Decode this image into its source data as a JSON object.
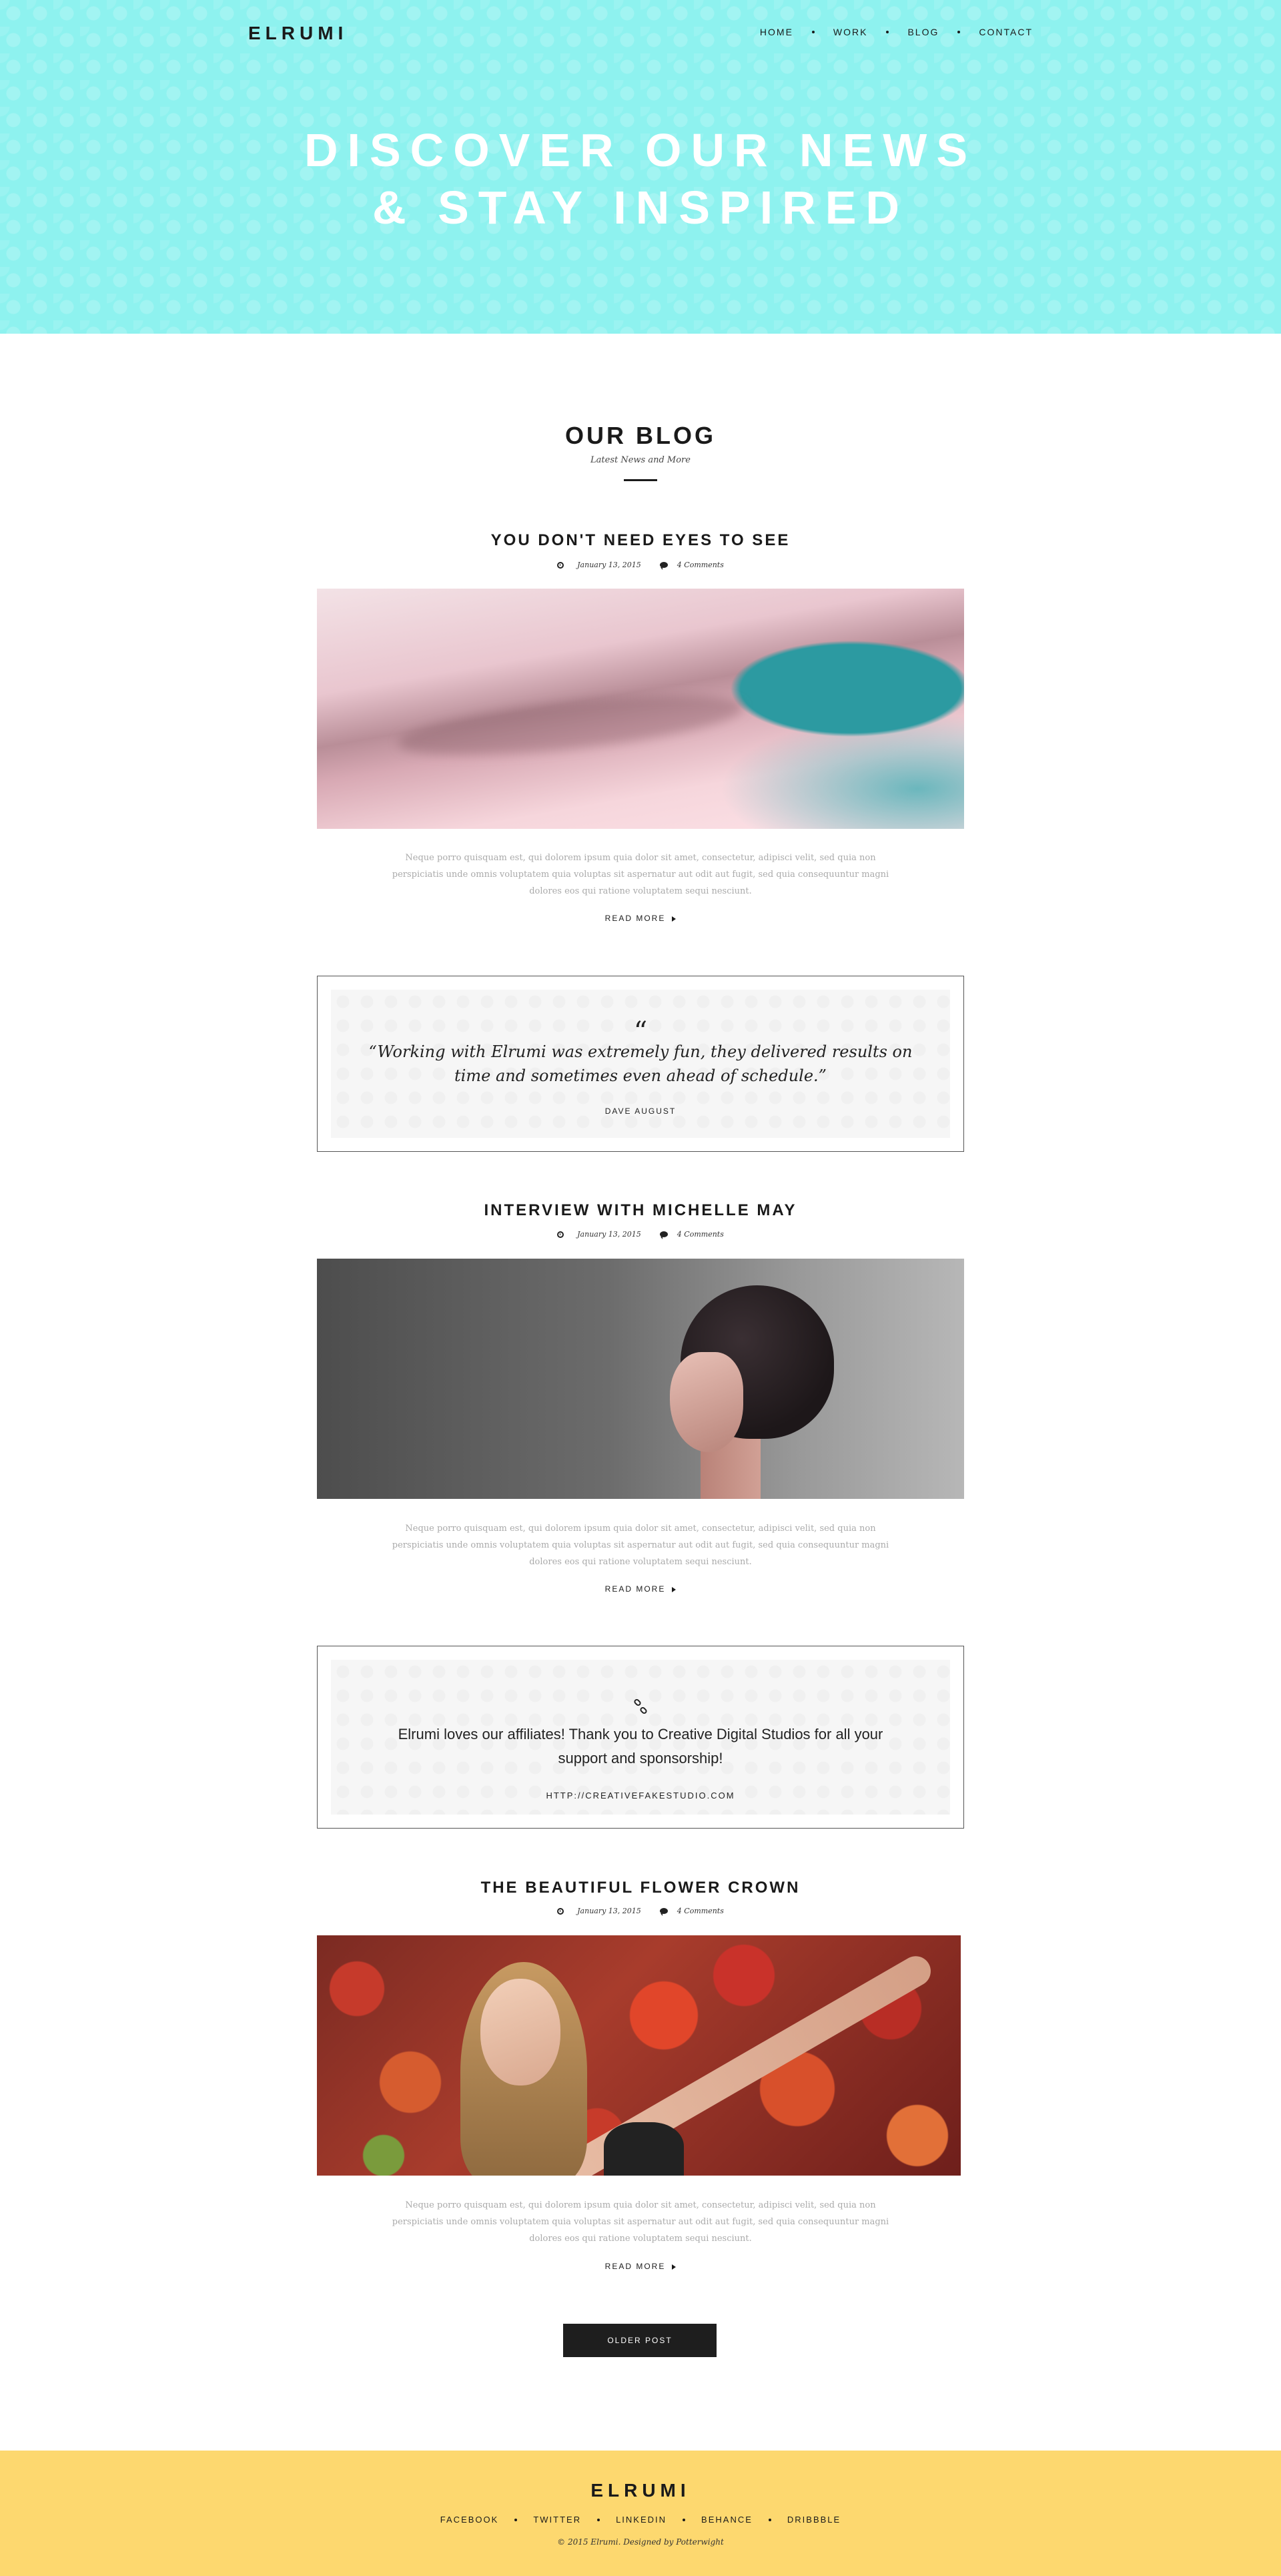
{
  "header": {
    "logo": "ELRUMI",
    "nav": [
      "HOME",
      "WORK",
      "BLOG",
      "CONTACT"
    ]
  },
  "hero": {
    "line1": "DISCOVER OUR NEWS",
    "line2": "& STAY INSPIRED",
    "bg_color": "#8ef2ef"
  },
  "blog": {
    "title": "OUR BLOG",
    "subtitle": "Latest News and More"
  },
  "posts": [
    {
      "title": "YOU DON'T NEED EYES TO SEE",
      "date": "January 13, 2015",
      "comments": "4 Comments",
      "excerpt": "Neque porro quisquam est, qui dolorem ipsum quia dolor sit amet, consectetur, adipisci velit, sed quia non perspiciatis unde omnis voluptatem quia voluptas sit aspernatur aut odit aut fugit, sed quia consequuntur magni dolores eos qui ratione voluptatem sequi nesciunt.",
      "read_more": "READ MORE"
    },
    {
      "title": "INTERVIEW WITH MICHELLE MAY",
      "date": "January 13, 2015",
      "comments": "4 Comments",
      "excerpt": "Neque porro quisquam est, qui dolorem ipsum quia dolor sit amet, consectetur, adipisci velit, sed quia non perspiciatis unde omnis voluptatem quia voluptas sit aspernatur aut odit aut fugit, sed quia consequuntur magni dolores eos qui ratione voluptatem sequi nesciunt.",
      "read_more": "READ MORE"
    },
    {
      "title": "THE BEAUTIFUL FLOWER CROWN",
      "date": "January 13, 2015",
      "comments": "4 Comments",
      "excerpt": "Neque porro quisquam est, qui dolorem ipsum quia dolor sit amet, consectetur, adipisci velit, sed quia non perspiciatis unde omnis voluptatem quia voluptas sit aspernatur aut odit aut fugit, sed quia consequuntur magni dolores eos qui ratione voluptatem sequi nesciunt.",
      "read_more": "READ MORE"
    }
  ],
  "quote": {
    "mark": "“",
    "text": "“Working with Elrumi was extremely fun, they delivered results on time and sometimes even ahead of schedule.”",
    "author": "DAVE AUGUST"
  },
  "link_card": {
    "icon": "link-icon",
    "text": "Elrumi loves our affiliates! Thank you to Creative Digital Studios for all your support and sponsorship!",
    "url": "HTTP://CREATIVEFAKESTUDIO.COM"
  },
  "pagination": {
    "older": "OLDER POST"
  },
  "footer": {
    "logo": "ELRUMI",
    "social": [
      "FACEBOOK",
      "TWITTER",
      "LINKEDIN",
      "BEHANCE",
      "DRIBBBLE"
    ],
    "copyright": "© 2015 Elrumi. Designed by Potterwight",
    "bg_color": "#fdd86f"
  }
}
